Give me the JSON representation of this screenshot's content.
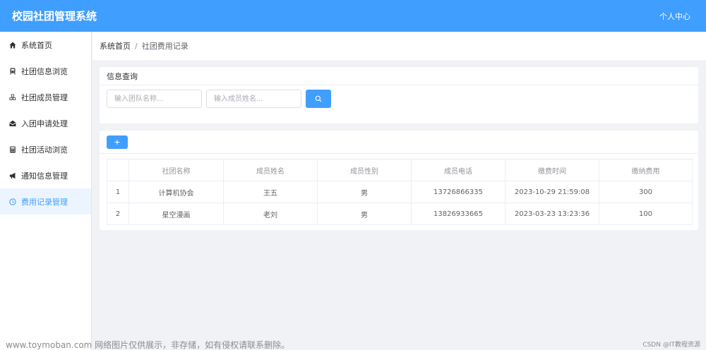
{
  "header": {
    "title": "校园社团管理系统",
    "user_center": "个人中心"
  },
  "sidebar": {
    "items": [
      {
        "label": "系统首页",
        "icon": "home-icon"
      },
      {
        "label": "社团信息浏览",
        "icon": "train-icon"
      },
      {
        "label": "社团成员管理",
        "icon": "cubes-icon"
      },
      {
        "label": "入团申请处理",
        "icon": "envelope-icon"
      },
      {
        "label": "社团活动浏览",
        "icon": "calculator-icon"
      },
      {
        "label": "通知信息管理",
        "icon": "bullhorn-icon"
      },
      {
        "label": "费用记录管理",
        "icon": "clock-icon"
      }
    ],
    "active_index": 6
  },
  "breadcrumb": {
    "home": "系统首页",
    "separator": "/",
    "current": "社团费用记录"
  },
  "search": {
    "title": "信息查询",
    "team_placeholder": "输入团队名称...",
    "member_placeholder": "输入成员姓名...",
    "button_icon": "search-icon"
  },
  "toolbar": {
    "add_label": "+"
  },
  "table": {
    "columns": [
      "",
      "社团名称",
      "成员姓名",
      "成员性别",
      "成员电话",
      "缴费时间",
      "缴纳费用"
    ],
    "rows": [
      [
        "1",
        "计算机协会",
        "王五",
        "男",
        "13726866335",
        "2023-10-29 21:59:08",
        "300"
      ],
      [
        "2",
        "星空漫画",
        "老刘",
        "男",
        "13826933665",
        "2023-03-23 13:23:36",
        "100"
      ]
    ]
  },
  "watermark": {
    "left": "www.toymoban.com 网络图片仅供展示，非存储，如有侵权请联系删除。",
    "right": "CSDN @IT教程资源"
  },
  "colors": {
    "primary": "#409eff",
    "sidebar_active_bg": "#ecf5ff",
    "page_bg": "#f0f2f5"
  }
}
